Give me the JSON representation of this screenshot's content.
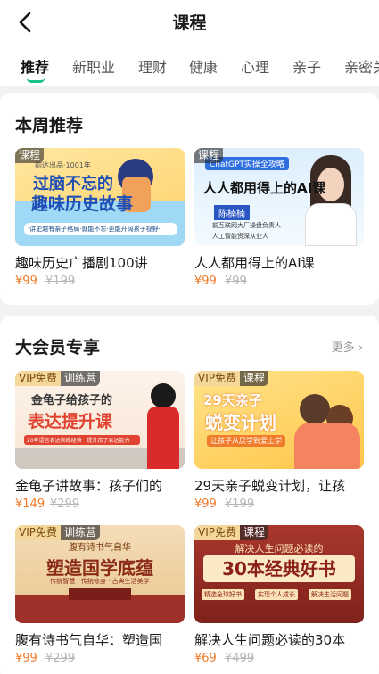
{
  "header": {
    "title": "课程"
  },
  "tabs": [
    "推荐",
    "新职业",
    "理财",
    "健康",
    "心理",
    "亲子",
    "亲密关"
  ],
  "weekly": {
    "title": "本周推荐",
    "items": [
      {
        "badge": "课程",
        "art_small": "韵达出品·1001年",
        "art_title1": "过脑不忘的",
        "art_title2": "趣味历史故事",
        "art_sub": "·讲史越有亲子格局·就能不忘·更能开阔孩子视野·",
        "title": "趣味历史广播剧100讲",
        "price": "¥99",
        "orig": "¥199"
      },
      {
        "badge": "课程",
        "art_small": "ChatGPT实操全攻略",
        "art_title": "人人都用得上的AI课",
        "art_name": "陈楠楠",
        "art_line1": "前互联网大厂操盘负责人",
        "art_line2": "人工智能资深从业人",
        "title": "人人都用得上的AI课",
        "price": "¥99",
        "orig": "¥99"
      }
    ]
  },
  "vip": {
    "title": "大会员专享",
    "more": "更多",
    "items": [
      {
        "vip": "VIP免费",
        "badge": "训练营",
        "art_top": "金龟子给孩子的",
        "art_title": "表达提升课",
        "art_small": "20年语言表达训练经验 · 提升孩子表达能力",
        "title": "金龟子讲故事：孩子们的",
        "price": "¥149",
        "orig": "¥299"
      },
      {
        "vip": "VIP免费",
        "badge": "课程",
        "art_top": "29天亲子",
        "art_title": "蜕变计划",
        "art_small": "让孩子从厌学到爱上学",
        "title": "29天亲子蜕变计划，让孩",
        "price": "¥99",
        "orig": "¥199"
      },
      {
        "vip": "VIP免费",
        "badge": "训练营",
        "art_top": "腹有诗书气自华",
        "art_title": "塑造国学底蕴",
        "art_small": "传统智慧 · 传统修身 · 古典生活美学",
        "title": "腹有诗书气自华：塑造国",
        "price": "¥99",
        "orig": "¥299"
      },
      {
        "vip": "VIP免费",
        "badge": "课程",
        "art_top": "解决人生问题必读的",
        "art_title": "30本经典好书",
        "art_small1": "精选全球好书",
        "art_small2": "实现个人成长",
        "art_small3": "解决生活问题",
        "title": "解决人生问题必读的30本",
        "price": "¥69",
        "orig": "¥499"
      }
    ]
  },
  "colors": {
    "accent": "#19c28a",
    "price": "#f07b2a"
  }
}
